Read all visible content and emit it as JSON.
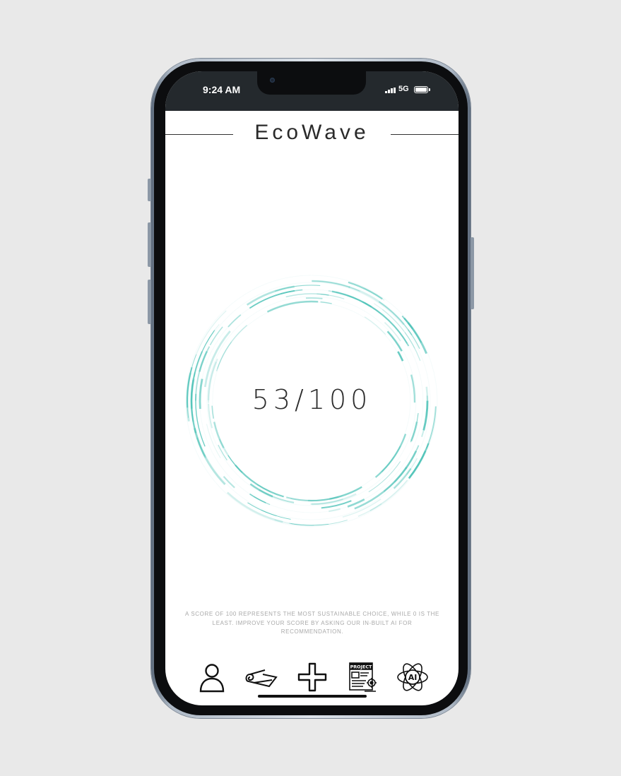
{
  "status_bar": {
    "time": "9:24 AM",
    "network": "5G",
    "signal_icon": "signal-bars-icon",
    "battery_icon": "battery-full-icon"
  },
  "app": {
    "title": "EcoWave"
  },
  "score": {
    "display": "53/100",
    "value": 53,
    "max": 100,
    "ring_color": "#4fc3b8",
    "note": "A score of 100 represents the most sustainable choice, while 0 is the least. Improve your score by asking our in-built AI for recommendation."
  },
  "bottom_nav": {
    "items": [
      {
        "icon": "user-icon"
      },
      {
        "icon": "mat-roll-icon"
      },
      {
        "icon": "plus-icon"
      },
      {
        "icon": "project-document-icon",
        "text": "PROJECT"
      },
      {
        "icon": "ai-atom-icon",
        "text": "AI"
      }
    ]
  },
  "colors": {
    "background": "#e9e9e9",
    "status_bar": "#24292d",
    "accent": "#4fc3b8",
    "text": "#2a2a2a"
  }
}
